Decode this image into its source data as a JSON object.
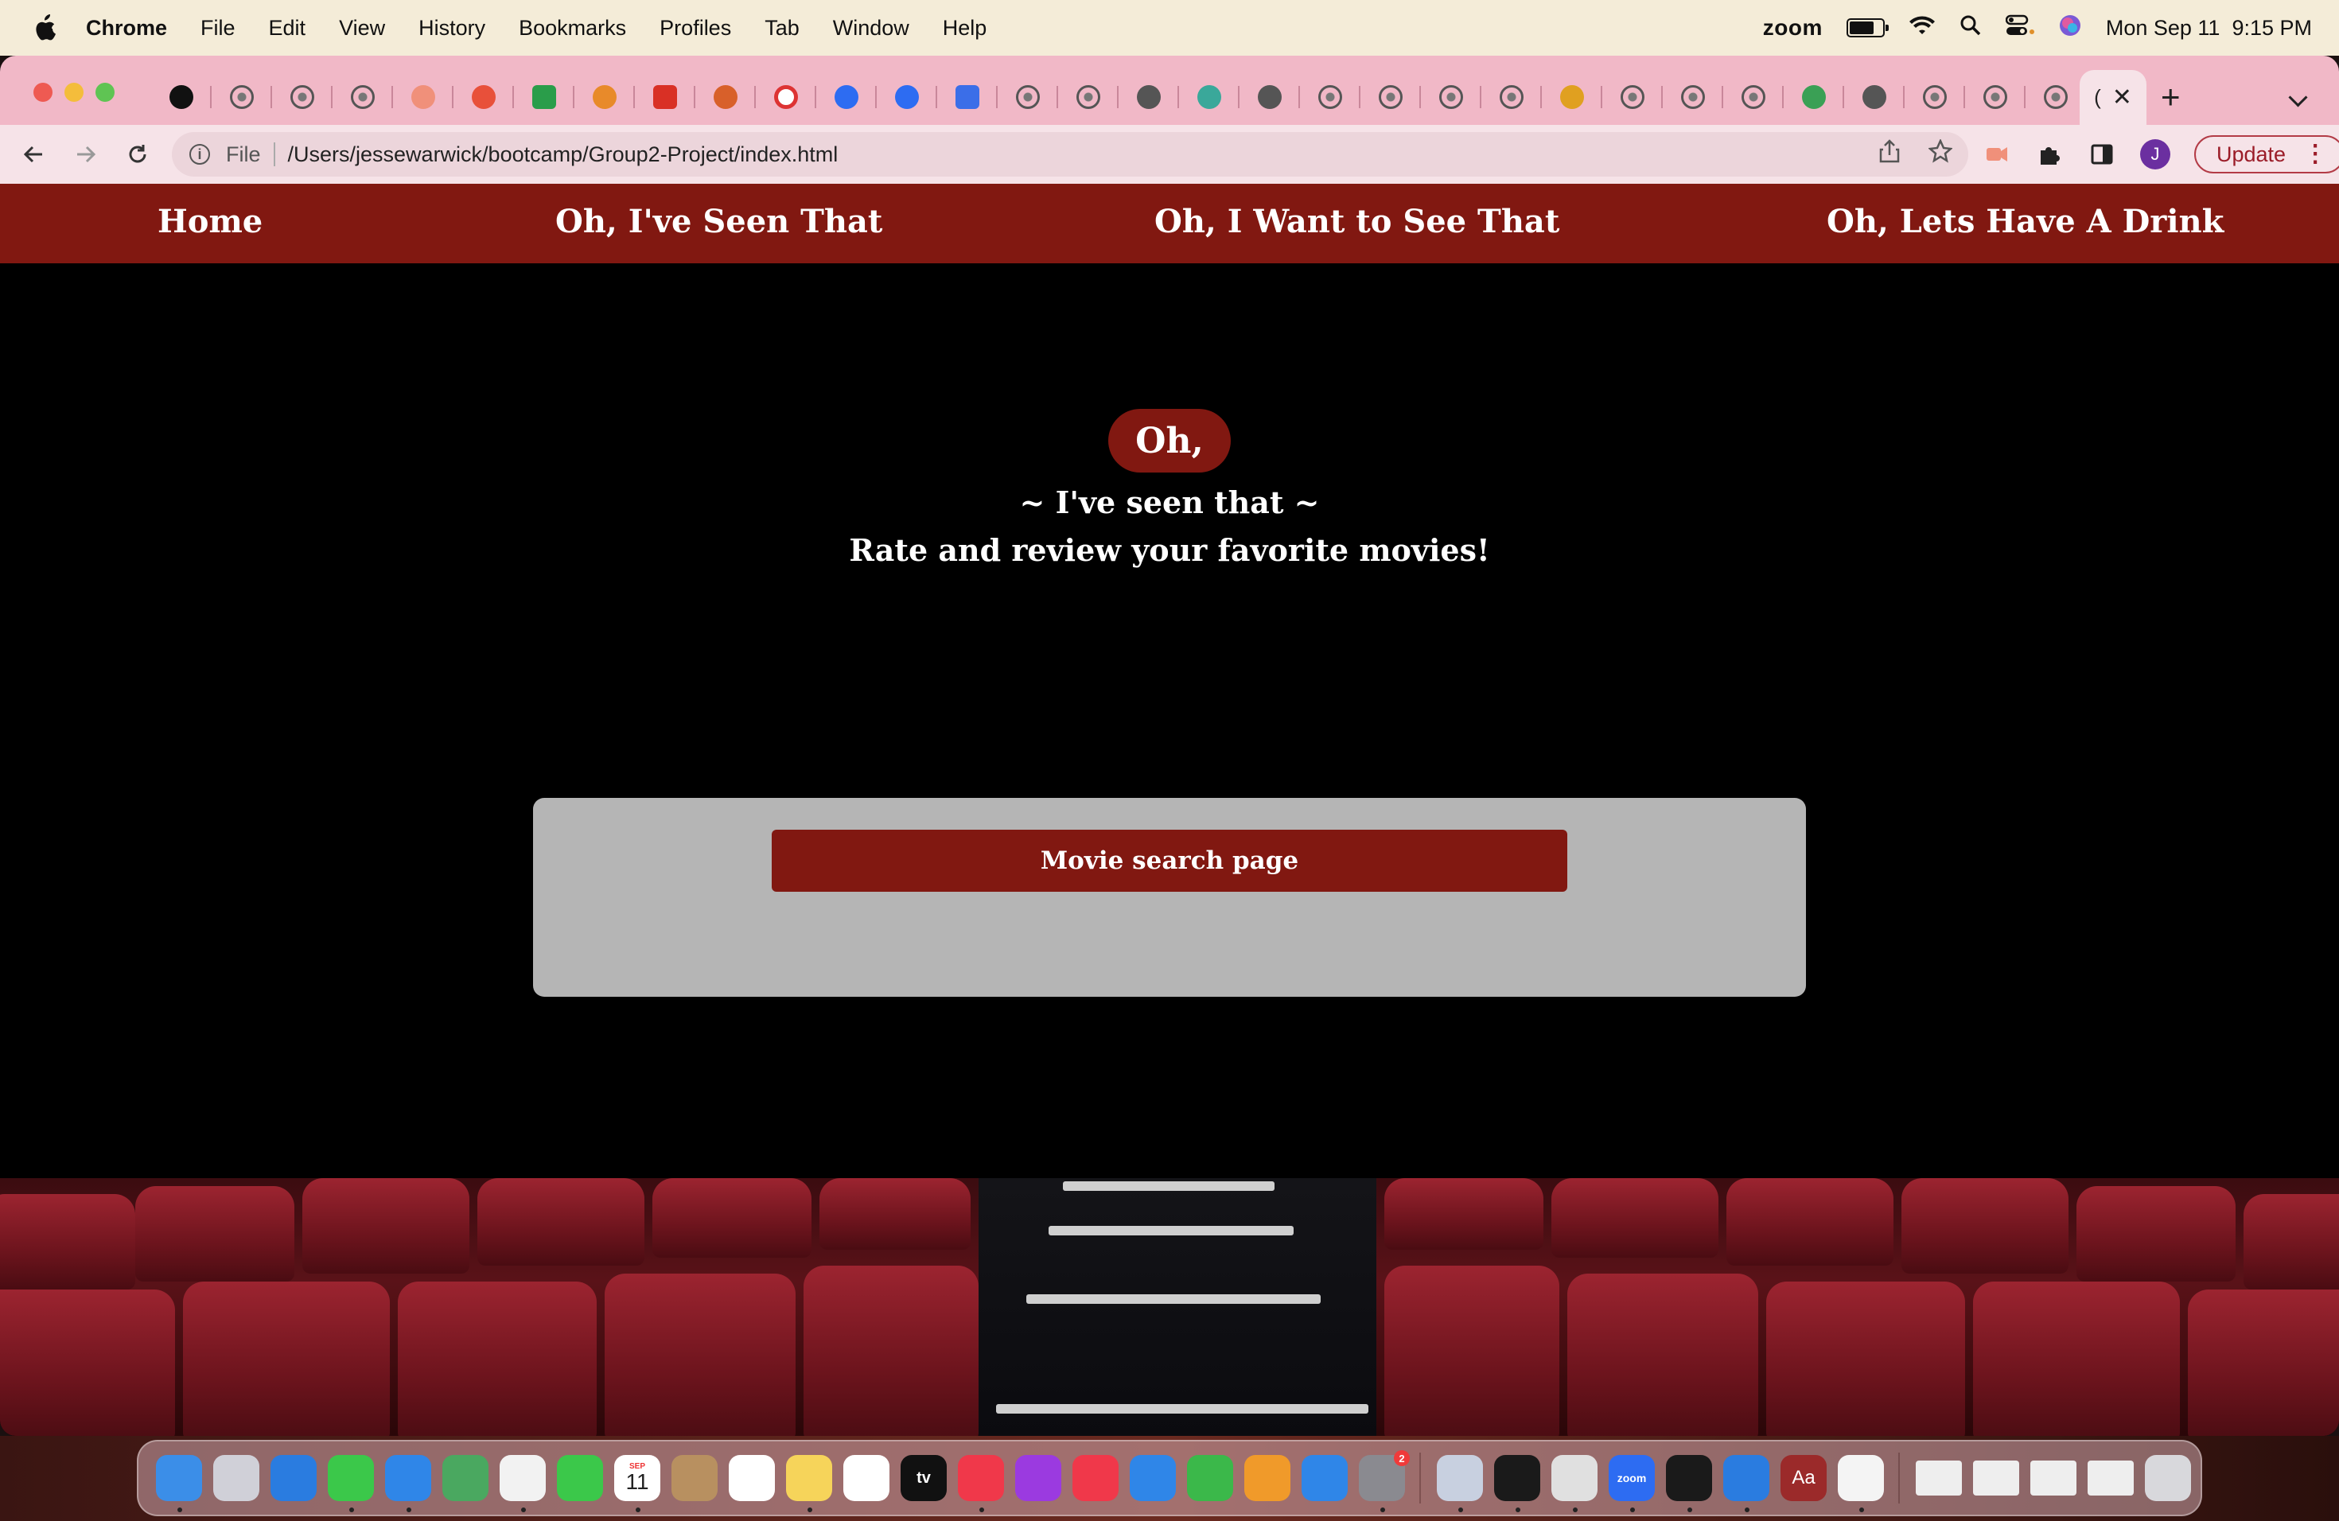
{
  "menubar": {
    "app_name": "Chrome",
    "menus": [
      "File",
      "Edit",
      "View",
      "History",
      "Bookmarks",
      "Profiles",
      "Tab",
      "Window",
      "Help"
    ],
    "status_zoom": "zoom",
    "battery_level": 0.75,
    "datetime": "Mon Sep 11  9:15 PM"
  },
  "browser": {
    "active_tab_title": "(",
    "tab_icons": [
      "github-icon",
      "globe-icon",
      "globe-icon",
      "globe-icon",
      "screencast-icon",
      "asterisk-icon",
      "google-drive-icon",
      "stack-icon",
      "gmail-icon",
      "helmet-icon",
      "opera-icon",
      "zoom-icon",
      "zoom-icon",
      "docs-icon",
      "globe-icon",
      "globe-icon",
      "chatgpt-icon",
      "openai-icon",
      "chatgpt-icon",
      "globe-icon",
      "globe-icon",
      "globe-icon",
      "globe-icon",
      "chrome-icon",
      "globe-icon",
      "globe-icon",
      "globe-icon",
      "checkmark-icon",
      "chatgpt-icon",
      "globe-icon",
      "globe-icon",
      "globe-icon"
    ],
    "address": {
      "scheme_label": "File",
      "url": "/Users/jessewarwick/bootcamp/Group2-Project/index.html"
    },
    "profile_initial": "J",
    "update_label": "Update",
    "colors": {
      "tabstrip": "#f1b8c7",
      "toolbar": "#f6e3e8"
    }
  },
  "site": {
    "nav": [
      {
        "label": "Home"
      },
      {
        "label": "Oh, I've Seen That"
      },
      {
        "label": "Oh, I Want to See That"
      },
      {
        "label": "Oh, Lets Have A Drink"
      }
    ],
    "hero": {
      "badge": "Oh,",
      "subtitle": "~ I've seen that ~",
      "tagline": "Rate and review your favorite movies!"
    },
    "search_button": "Movie search page",
    "colors": {
      "brand": "#811811",
      "card": "#b5b5b5"
    }
  },
  "dock": {
    "apps": [
      "finder-icon",
      "launchpad-icon",
      "safari-icon",
      "messages-icon",
      "mail-icon",
      "maps-icon",
      "photos-icon",
      "facetime-icon",
      "calendar-icon",
      "contacts-icon",
      "reminders-icon",
      "notes-icon",
      "freeform-icon",
      "apple-tv-icon",
      "music-icon",
      "podcasts-icon",
      "news-icon",
      "keynote-icon",
      "numbers-icon",
      "pages-icon",
      "app-store-icon",
      "system-settings-icon",
      "preview-icon",
      "terminal-icon",
      "chrome-icon",
      "zoom-icon",
      "activity-monitor-icon",
      "vscode-icon",
      "dictionary-icon",
      "slack-icon",
      "trash-icon"
    ],
    "calendar_month": "SEP",
    "calendar_day": "11",
    "tv_label": "tv",
    "zoom_label": "zoom",
    "dictionary_label": "Aa",
    "settings_badge": "2"
  }
}
